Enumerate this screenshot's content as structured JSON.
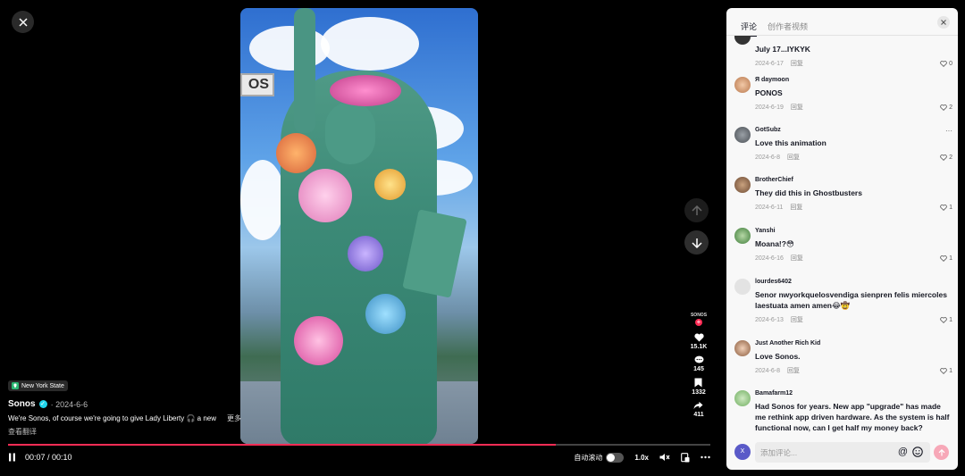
{
  "video": {
    "sign_text": "os",
    "location": "New York State",
    "author": "Sonos",
    "date": "2024-6-6",
    "description": "We're Sonos, of course we're going to give Lady Liberty 🎧 a new",
    "more_label": "更多",
    "translate_label": "查看翻译",
    "progress_fraction": 0.78
  },
  "actions": {
    "avatar_label": "SONOS",
    "likes": "15.1K",
    "comments": "145",
    "saves": "1332",
    "shares": "411"
  },
  "controls": {
    "time": "00:07 / 00:10",
    "autoscroll_label": "自动滚动",
    "speed": "1.0x"
  },
  "panel": {
    "tabs": [
      {
        "label": "评论",
        "active": true
      },
      {
        "label": "创作者视频",
        "active": false
      }
    ],
    "reply_label": "回复",
    "input_placeholder": "添加评论...",
    "me_initial": "X",
    "comments": [
      {
        "user": "",
        "text": "July 17...IYKYK",
        "date": "2024-6-17",
        "likes": "0"
      },
      {
        "user": "Я daymoon",
        "text": "PONOS",
        "date": "2024-6-19",
        "likes": "2"
      },
      {
        "user": "GotSubz",
        "text": "Love this animation",
        "date": "2024-6-8",
        "likes": "2"
      },
      {
        "user": "BrotherChief",
        "text": "They did this in Ghostbusters",
        "date": "2024-6-11",
        "likes": "1"
      },
      {
        "user": "Yanshi",
        "text": "Moana!?😳",
        "date": "2024-6-16",
        "likes": "1"
      },
      {
        "user": "lourdes6402",
        "text": "Senor nwyorkquelosvendiga sienpren felis miercoles laestuata amen amen😂🤠",
        "date": "2024-6-13",
        "likes": "1"
      },
      {
        "user": "Just Another Rich Kid",
        "text": "Love Sonos.",
        "date": "2024-6-8",
        "likes": "1"
      },
      {
        "user": "Bamafarm12",
        "text": "Had Sonos for years. New app \"upgrade\" has made me rethink app driven hardware. As the system is half functional now, can I get half my money back?",
        "date": "",
        "likes": ""
      }
    ]
  },
  "colors": {
    "accent": "#fe2c55",
    "verified": "#20d5ec",
    "panel_bg": "#f8f8f8"
  }
}
